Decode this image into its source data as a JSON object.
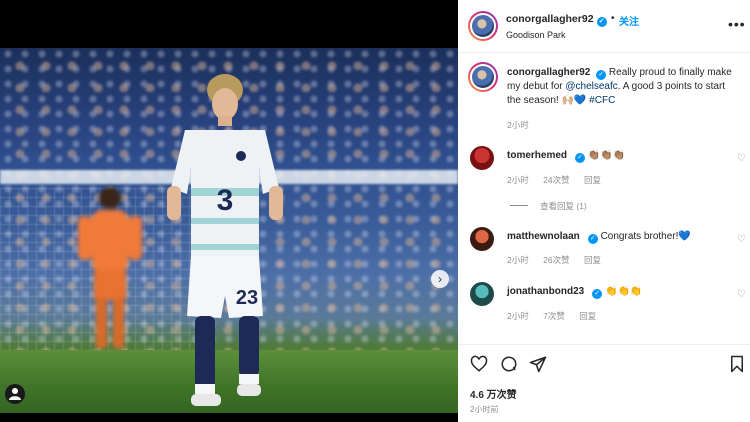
{
  "post": {
    "author": "conorgallagher92",
    "follow_label": "关注",
    "separator": "•",
    "location": "Goodison Park",
    "more_label": "•••"
  },
  "caption": {
    "author": "conorgallagher92",
    "text_before_link": "Really proud to finally make my debut for ",
    "link": "@chelseafc",
    "text_after_link": ". A good 3 points to start the season! 🙌🏼💙 ",
    "hashtag": "#CFC",
    "time": "2小时"
  },
  "comments": [
    {
      "user": "tomerhemed",
      "verified": true,
      "text": "👏🏽👏🏽👏🏽",
      "time": "2小时",
      "likes": "24次赞",
      "reply": "回复"
    },
    {
      "user": "matthewnolaan",
      "verified": true,
      "text": "Congrats brother!💙",
      "time": "2小时",
      "likes": "26次赞",
      "reply": "回复"
    },
    {
      "user": "jonathanbond23",
      "verified": true,
      "text": "👏👏👏",
      "time": "2小时",
      "likes": "7次赞",
      "reply": "回复"
    }
  ],
  "view_replies": "查看回复 (1)",
  "stats": {
    "likes": "4.6 万次赞",
    "time": "2小时前"
  },
  "photo": {
    "shirt_number": "23",
    "sponsor": "3"
  },
  "colors": {
    "accent": "#0095f6",
    "link": "#00376b",
    "muted": "#8e8e8e"
  }
}
